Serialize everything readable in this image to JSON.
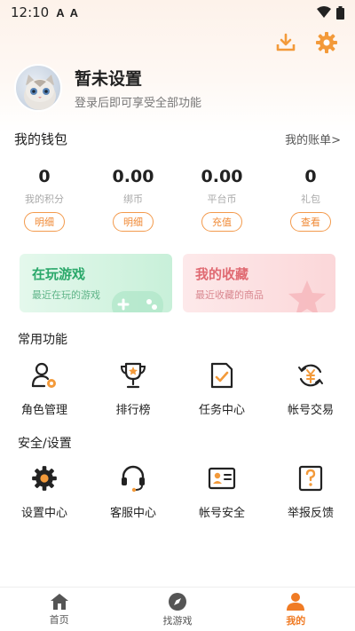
{
  "status_bar": {
    "time": "12:10",
    "icon_a1": "A",
    "icon_a2": "A",
    "wifi": "wifi-icon",
    "battery": "battery-icon"
  },
  "header": {
    "download": "download-icon",
    "settings": "gear-icon",
    "accent": "#f39a3a"
  },
  "profile": {
    "name": "暂未设置",
    "subtitle": "登录后即可享受全部功能"
  },
  "wallet": {
    "title": "我的钱包",
    "link": "我的账单>",
    "items": [
      {
        "value": "0",
        "label": "我的积分",
        "button": "明细"
      },
      {
        "value": "0.00",
        "label": "绑币",
        "button": "明细"
      },
      {
        "value": "0.00",
        "label": "平台币",
        "button": "充值"
      },
      {
        "value": "0",
        "label": "礼包",
        "button": "查看"
      }
    ]
  },
  "cards": [
    {
      "title": "在玩游戏",
      "subtitle": "最近在玩的游戏"
    },
    {
      "title": "我的收藏",
      "subtitle": "最近收藏的商品"
    }
  ],
  "common": {
    "title": "常用功能",
    "items": [
      {
        "label": "角色管理",
        "icon": "role-icon"
      },
      {
        "label": "排行榜",
        "icon": "trophy-icon"
      },
      {
        "label": "任务中心",
        "icon": "task-icon"
      },
      {
        "label": "帐号交易",
        "icon": "trade-icon"
      }
    ]
  },
  "security": {
    "title": "安全/设置",
    "items": [
      {
        "label": "设置中心",
        "icon": "settings-icon"
      },
      {
        "label": "客服中心",
        "icon": "headset-icon"
      },
      {
        "label": "帐号安全",
        "icon": "id-card-icon"
      },
      {
        "label": "举报反馈",
        "icon": "report-icon"
      }
    ]
  },
  "nav": [
    {
      "label": "首页",
      "icon": "home-icon"
    },
    {
      "label": "找游戏",
      "icon": "compass-icon"
    },
    {
      "label": "我的",
      "icon": "user-icon"
    }
  ]
}
